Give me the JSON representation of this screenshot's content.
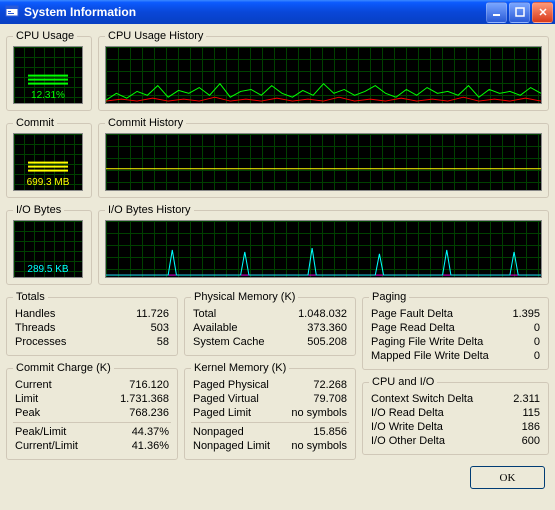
{
  "title": "System Information",
  "gauges": {
    "cpu_usage": {
      "label": "CPU Usage",
      "value": "12.31%"
    },
    "commit": {
      "label": "Commit",
      "value": "699.3 MB"
    },
    "io_bytes": {
      "label": "I/O Bytes",
      "value": "289.5 KB"
    },
    "cpu_history": {
      "label": "CPU Usage History"
    },
    "commit_history": {
      "label": "Commit History"
    },
    "io_history": {
      "label": "I/O Bytes History"
    }
  },
  "totals": {
    "legend": "Totals",
    "handles": {
      "label": "Handles",
      "value": "11.726"
    },
    "threads": {
      "label": "Threads",
      "value": "503"
    },
    "processes": {
      "label": "Processes",
      "value": "58"
    }
  },
  "commit_charge": {
    "legend": "Commit Charge (K)",
    "current": {
      "label": "Current",
      "value": "716.120"
    },
    "limit": {
      "label": "Limit",
      "value": "1.731.368"
    },
    "peak": {
      "label": "Peak",
      "value": "768.236"
    },
    "peak_limit": {
      "label": "Peak/Limit",
      "value": "44.37%"
    },
    "current_limit": {
      "label": "Current/Limit",
      "value": "41.36%"
    }
  },
  "physical_memory": {
    "legend": "Physical Memory (K)",
    "total": {
      "label": "Total",
      "value": "1.048.032"
    },
    "available": {
      "label": "Available",
      "value": "373.360"
    },
    "system_cache": {
      "label": "System Cache",
      "value": "505.208"
    }
  },
  "kernel_memory": {
    "legend": "Kernel Memory (K)",
    "paged_physical": {
      "label": "Paged Physical",
      "value": "72.268"
    },
    "paged_virtual": {
      "label": "Paged Virtual",
      "value": "79.708"
    },
    "paged_limit": {
      "label": "Paged Limit",
      "value": "no symbols"
    },
    "nonpaged": {
      "label": "Nonpaged",
      "value": "15.856"
    },
    "nonpaged_limit": {
      "label": "Nonpaged Limit",
      "value": "no symbols"
    }
  },
  "paging": {
    "legend": "Paging",
    "page_fault_delta": {
      "label": "Page Fault Delta",
      "value": "1.395"
    },
    "page_read_delta": {
      "label": "Page Read Delta",
      "value": "0"
    },
    "paging_file_write_delta": {
      "label": "Paging File Write Delta",
      "value": "0"
    },
    "mapped_file_write_delta": {
      "label": "Mapped File Write Delta",
      "value": "0"
    }
  },
  "cpu_io": {
    "legend": "CPU and I/O",
    "context_switch_delta": {
      "label": "Context Switch Delta",
      "value": "2.311"
    },
    "io_read_delta": {
      "label": "I/O Read Delta",
      "value": "115"
    },
    "io_write_delta": {
      "label": "I/O Write Delta",
      "value": "186"
    },
    "io_other_delta": {
      "label": "I/O Other Delta",
      "value": "600"
    }
  },
  "ok_label": "OK"
}
